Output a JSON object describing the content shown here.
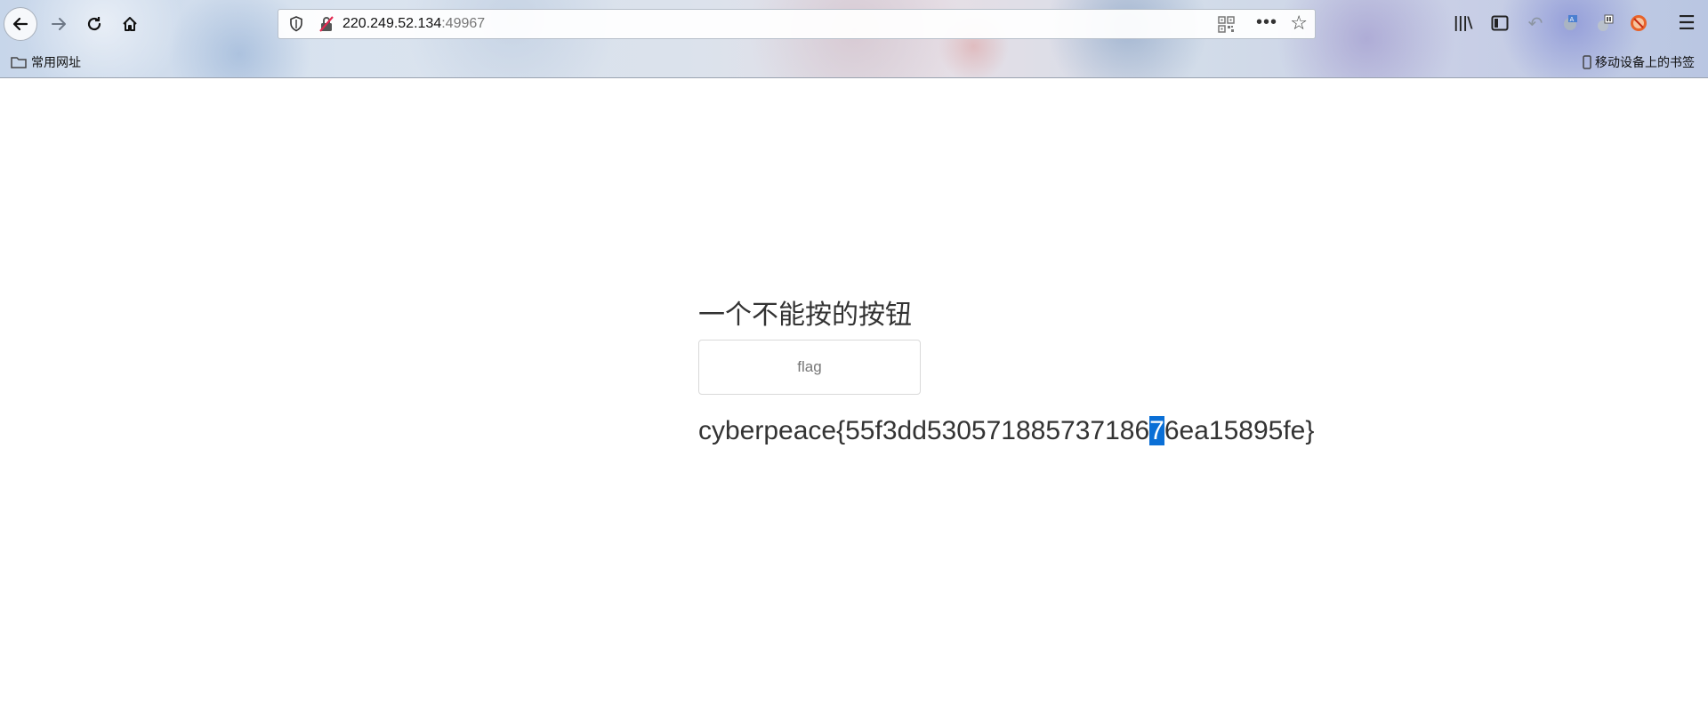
{
  "browser": {
    "url_host": "220.249.52.134",
    "url_port": ":49967",
    "bookmarks": {
      "folder_label": "常用网址",
      "mobile_label": "移动设备上的书签"
    }
  },
  "page": {
    "title": "一个不能按的按钮",
    "button_label": "flag",
    "flag_before": "cyberpeace{55f3dd530571885737186",
    "flag_selected": "7",
    "flag_after": "6ea15895fe}"
  }
}
